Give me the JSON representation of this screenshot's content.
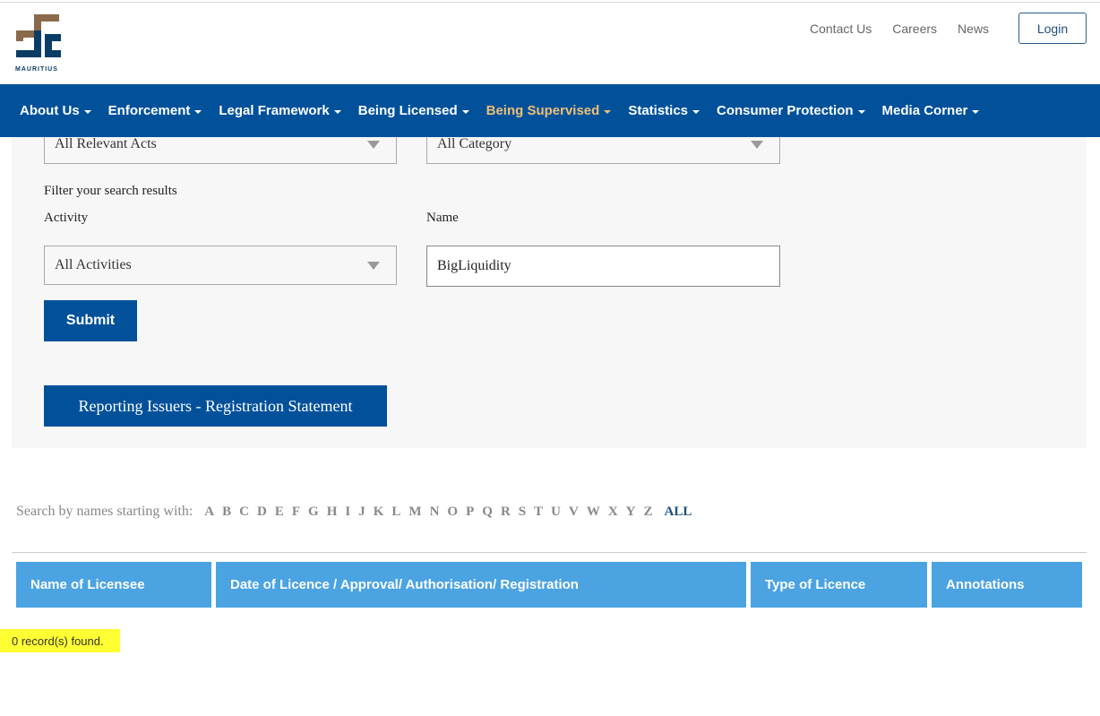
{
  "header": {
    "logo_text": "MAURITIUS",
    "links": [
      "Contact Us",
      "Careers",
      "News"
    ],
    "login_label": "Login"
  },
  "nav": {
    "items": [
      {
        "label": "About Us",
        "active": false
      },
      {
        "label": "Enforcement",
        "active": false
      },
      {
        "label": "Legal Framework",
        "active": false
      },
      {
        "label": "Being Licensed",
        "active": false
      },
      {
        "label": "Being Supervised",
        "active": true
      },
      {
        "label": "Statistics",
        "active": false
      },
      {
        "label": "Consumer Protection",
        "active": false
      },
      {
        "label": "Media Corner",
        "active": false
      }
    ],
    "active_color": "#f0be75",
    "bg_color": "#00519a"
  },
  "filters": {
    "acts_value": "All Relevant Acts",
    "category_value": "All Category",
    "filter_heading": "Filter your search results",
    "activity_label": "Activity",
    "name_label": "Name",
    "activity_value": "All Activities",
    "name_value": "BigLiquidity",
    "submit_label": "Submit",
    "report_label": "Reporting Issuers - Registration Statement"
  },
  "alphabet": {
    "label": "Search by names starting with:",
    "letters": [
      "A",
      "B",
      "C",
      "D",
      "E",
      "F",
      "G",
      "H",
      "I",
      "J",
      "K",
      "L",
      "M",
      "N",
      "O",
      "P",
      "Q",
      "R",
      "S",
      "T",
      "U",
      "V",
      "W",
      "X",
      "Y",
      "Z"
    ],
    "all_label": "ALL"
  },
  "table": {
    "columns": [
      "Name of Licensee",
      "Date of Licence / Approval/ Authorisation/ Registration",
      "Type of Licence",
      "Annotations"
    ],
    "header_color": "#4ba3e2"
  },
  "results": {
    "count_text": "0 record(s) found."
  }
}
